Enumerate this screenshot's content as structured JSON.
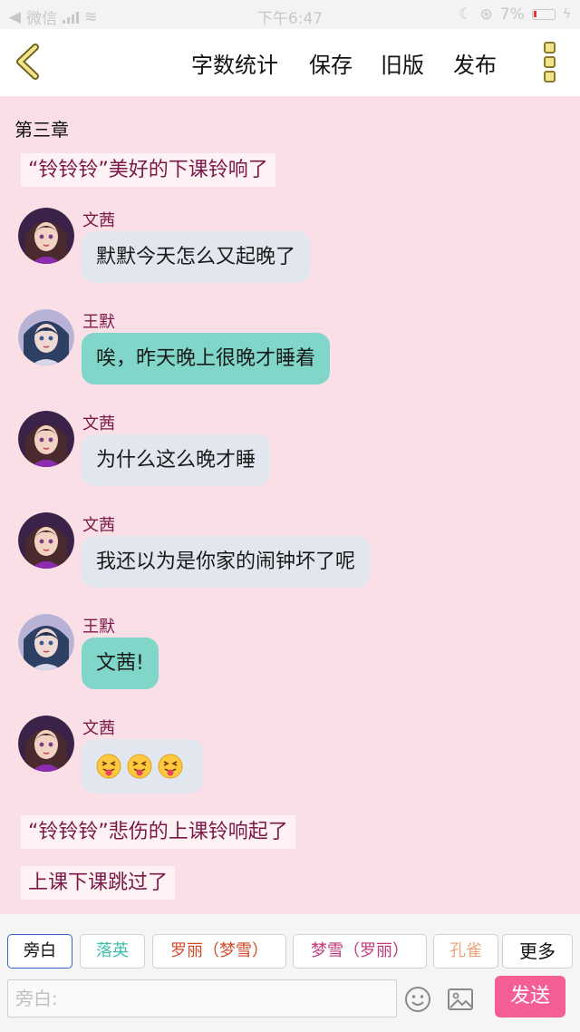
{
  "status": {
    "carrier": "微信",
    "time": "下午6:47",
    "battery": "7%"
  },
  "nav": {
    "word_count": "字数统计",
    "save": "保存",
    "old_version": "旧版",
    "publish": "发布"
  },
  "chapter": "第三章",
  "narrations": [
    "“铃铃铃”美好的下课铃响了",
    "“铃铃铃”悲伤的上课铃响起了",
    "上课下课跳过了"
  ],
  "messages": [
    {
      "sender": "文茜",
      "text": "默默今天怎么又起晚了"
    },
    {
      "sender": "王默",
      "text": "唉，昨天晚上很晚才睡着"
    },
    {
      "sender": "文茜",
      "text": "为什么这么晚才睡"
    },
    {
      "sender": "文茜",
      "text": "我还以为是你家的闹钟坏了呢"
    },
    {
      "sender": "王默",
      "text": "文茜!"
    },
    {
      "sender": "文茜",
      "emoji": [
        "squinting-tongue-face",
        "squinting-tongue-face",
        "squinting-tongue-face"
      ]
    }
  ],
  "roles": [
    {
      "label": "旁白",
      "color": "#222222"
    },
    {
      "label": "落英",
      "color": "#3dbfae"
    },
    {
      "label": "罗丽（梦雪）",
      "color": "#d24a2a"
    },
    {
      "label": "梦雪（罗丽）",
      "color": "#c0397a"
    },
    {
      "label": "孔雀",
      "color": "#f0a27a"
    },
    {
      "label": "更多",
      "color": "#111111"
    }
  ],
  "input": {
    "placeholder": "旁白:"
  },
  "send": "发送",
  "colors": {
    "bubble_wenqian": "#e2e6ee",
    "bubble_wangmo": "#7fd6c9",
    "send": "#f45e95",
    "background": "#fbdfe7"
  }
}
